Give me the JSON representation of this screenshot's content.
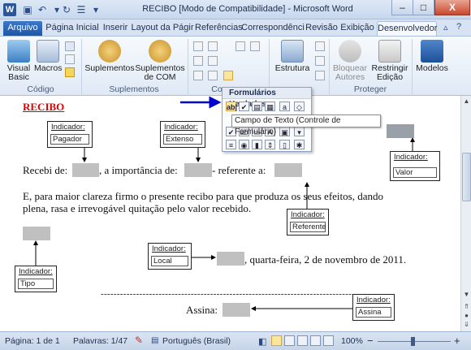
{
  "window": {
    "title": "RECIBO [Modo de Compatibilidade] - Microsoft Word",
    "minimize_glyph": "–",
    "maximize_glyph": "□",
    "close_glyph": "X"
  },
  "tabs": [
    {
      "label": "Arquivo"
    },
    {
      "label": "Página Inicial"
    },
    {
      "label": "Inserir"
    },
    {
      "label": "Layout da Págir"
    },
    {
      "label": "Referências"
    },
    {
      "label": "Correspondênci"
    },
    {
      "label": "Revisão"
    },
    {
      "label": "Exibição"
    },
    {
      "label": "Desenvolvedor"
    }
  ],
  "ribbon": {
    "groups": {
      "codigo": "Código",
      "suplementos": "Suplementos",
      "controles": "Co",
      "protect": "Proteger"
    },
    "buttons": {
      "visual_basic_1": "Visual",
      "visual_basic_2": "Basic",
      "macros": "Macros",
      "suplementos": "Suplementos",
      "sup_com_1": "Suplementos",
      "sup_com_2": "de COM",
      "estrutura": "Estrutura",
      "bloquear_1": "Bloquear",
      "bloquear_2": "Autores",
      "restringir_1": "Restringir",
      "restringir_2": "Edição",
      "modelos": "Modelos"
    }
  },
  "dropdown": {
    "heading": "Formulários Herdados",
    "tooltip": "Campo de Texto (Controle de Formulário)",
    "selected_icon": "ab|"
  },
  "document": {
    "title": "RECIBO",
    "line1_a": "Recebi  de:",
    "line1_b": ", a importância  de:",
    "line1_c": " - referente  a:",
    "para_1": "E, para maior  clareza firmo  o presente recibo para que produza os seus efeitos,  dando",
    "para_2": "plena, rasa e irrevogável  quitação  pelo valor  recebido.",
    "date_text": ", quarta-feira,  2 de novembro  de 2011.",
    "dash_line": "------------------------------------------------------------------------------------------",
    "assina": "Assina:",
    "indicator_label": "Indicador:",
    "indicators": {
      "pagador": "Pagador",
      "extenso": "Extenso",
      "valor": "Valor",
      "referente": "Referente",
      "tipo": "Tipo",
      "local": "Local",
      "assina": "Assina"
    }
  },
  "status": {
    "page": "Página: 1 de 1",
    "words": "Palavras: 1/47",
    "language": "Português (Brasil)",
    "zoom": "100%",
    "zoom_minus": "−",
    "zoom_plus": "+"
  },
  "colors": {
    "accent": "#2b579a",
    "title_red": "#e00000",
    "field_gray": "#c0c0c0",
    "arrow_blue": "#0000cc"
  }
}
